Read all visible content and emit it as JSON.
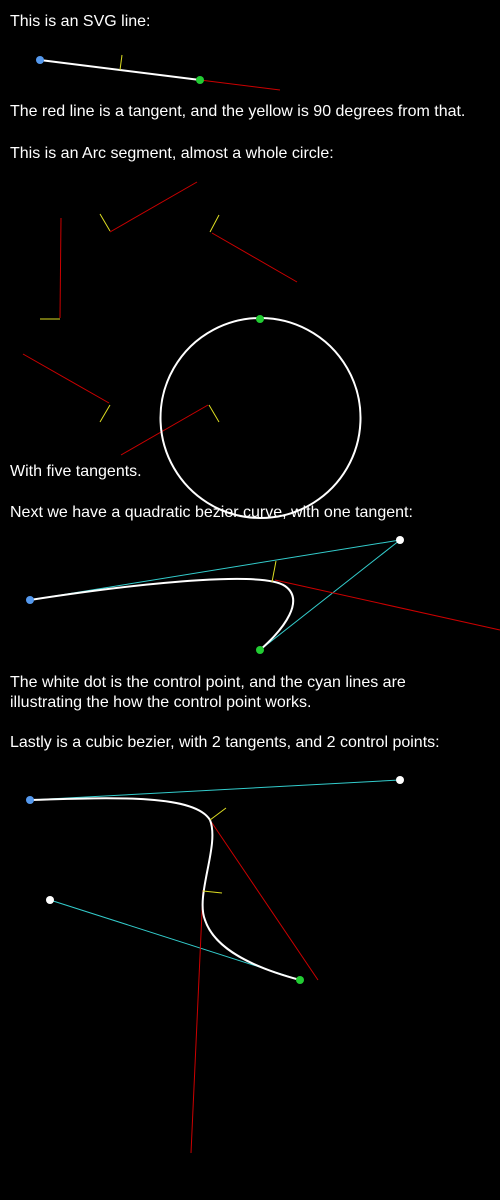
{
  "colors": {
    "background": "#000000",
    "text": "#ffffff",
    "path": "#ffffff",
    "tangent": "#cc0000",
    "normal": "#dddd22",
    "start_point": "#5599ee",
    "end_point": "#22cc33",
    "control_point": "#ffffff",
    "control_line": "#33cccc"
  },
  "captions": {
    "svg_line": "This is an SVG line:",
    "line_explanation": "The red line is a tangent, and the yellow is 90 degrees from that.",
    "arc_intro": "This is an Arc segment, almost a whole circle:",
    "arc_tangents": "With five tangents.",
    "quadratic_intro": "Next we have a quadratic bezier curve, with one tangent:",
    "control_explanation": "The white dot is the control point, and the cyan lines are illustrating the how the control point works.",
    "cubic_intro": "Lastly is a cubic bezier, with 2 tangents, and 2 control points:"
  },
  "figures": {
    "line_tangents": 1,
    "arc_tangents": 5,
    "quadratic_tangents": 1,
    "quadratic_control_points": 1,
    "cubic_tangents": 2,
    "cubic_control_points": 2
  }
}
